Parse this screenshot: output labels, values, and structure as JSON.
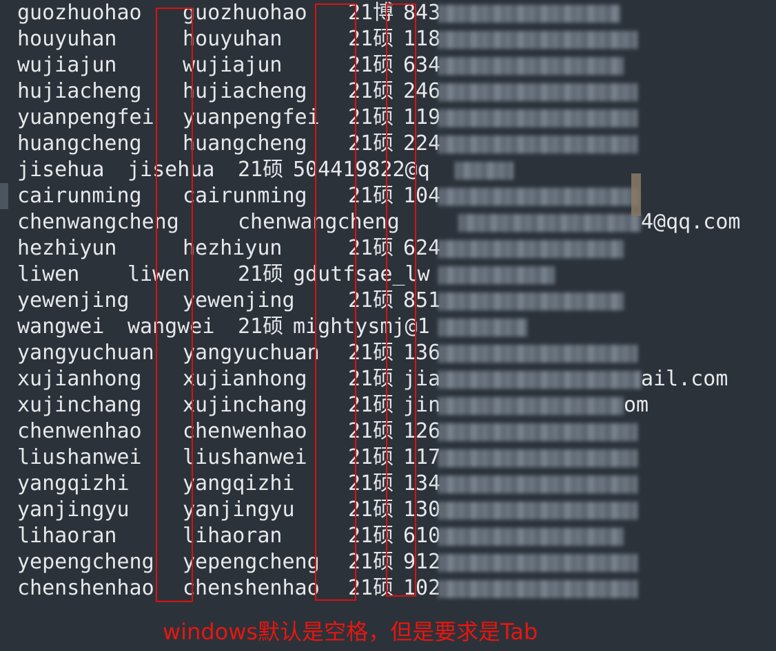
{
  "lines": [
    {
      "user": "guozhuohao",
      "login": "guozhuohao",
      "grade": "21博",
      "email_visible": "843",
      "email_tail": ""
    },
    {
      "user": "houyuhan",
      "login": "houyuhan",
      "grade": "21硕",
      "email_visible": "118",
      "email_tail": ""
    },
    {
      "user": "wujiajun",
      "login": "wujiajun",
      "grade": "21硕",
      "email_visible": "634",
      "email_tail": ""
    },
    {
      "user": "hujiacheng",
      "login": "hujiacheng",
      "grade": "21硕",
      "email_visible": "246",
      "email_tail": ""
    },
    {
      "user": "yuanpengfei",
      "login": "yuanpengfei",
      "grade": "21硕",
      "email_visible": "119",
      "email_tail": ""
    },
    {
      "user": "huangcheng",
      "login": "huangcheng",
      "grade": "21硕",
      "email_visible": "224",
      "email_tail": ""
    },
    {
      "user": "jisehua",
      "login": "jisehua",
      "grade": "21硕",
      "email_visible": "504419822@q",
      "email_tail": ""
    },
    {
      "user": "cairunming",
      "login": "cairunming",
      "grade": "21硕",
      "email_visible": "104",
      "email_tail": ""
    },
    {
      "user": "chenwangcheng",
      "login": "chenwangcheng",
      "grade": "",
      "email_visible": "",
      "email_tail": "4@qq.com"
    },
    {
      "user": "hezhiyun",
      "login": "hezhiyun",
      "grade": "21硕",
      "email_visible": "624",
      "email_tail": ""
    },
    {
      "user": "liwen",
      "login": "liwen",
      "grade": "21硕",
      "email_visible": "gdutfsae_lw",
      "email_tail": ""
    },
    {
      "user": "yewenjing",
      "login": "yewenjing",
      "grade": "21硕",
      "email_visible": "851",
      "email_tail": ""
    },
    {
      "user": "wangwei",
      "login": "wangwei",
      "grade": "21硕",
      "email_visible": "mightysmj@1",
      "email_tail": ""
    },
    {
      "user": "yangyuchuan",
      "login": "yangyuchuan",
      "grade": "21硕",
      "email_visible": "136",
      "email_tail": ""
    },
    {
      "user": "xujianhong",
      "login": "xujianhong",
      "grade": "21硕",
      "email_visible": "jia",
      "email_tail": "ail.com"
    },
    {
      "user": "xujinchang",
      "login": "xujinchang",
      "grade": "21硕",
      "email_visible": "jin",
      "email_tail": "om"
    },
    {
      "user": "chenwenhao",
      "login": "chenwenhao",
      "grade": "21硕",
      "email_visible": "126",
      "email_tail": ""
    },
    {
      "user": "liushanwei",
      "login": "liushanwei",
      "grade": "21硕",
      "email_visible": "117",
      "email_tail": ""
    },
    {
      "user": "yangqizhi",
      "login": "yangqizhi",
      "grade": "21硕",
      "email_visible": "134",
      "email_tail": ""
    },
    {
      "user": "yanjingyu",
      "login": "yanjingyu",
      "grade": "21硕",
      "email_visible": "130",
      "email_tail": ""
    },
    {
      "user": "lihaoran",
      "login": "lihaoran",
      "grade": "21硕",
      "email_visible": "610",
      "email_tail": ""
    },
    {
      "user": "yepengcheng",
      "login": "yepengcheng",
      "grade": "21硕",
      "email_visible": "912",
      "email_tail": ""
    },
    {
      "user": "chenshenhao",
      "login": "chenshenhao",
      "grade": "21硕",
      "email_visible": "102",
      "email_tail": ""
    }
  ],
  "annotation": "windows默认是空格，但是要求是Tab",
  "colors": {
    "background": "#2b323a",
    "text": "#e6e8ea",
    "annotation": "#e8160f"
  }
}
